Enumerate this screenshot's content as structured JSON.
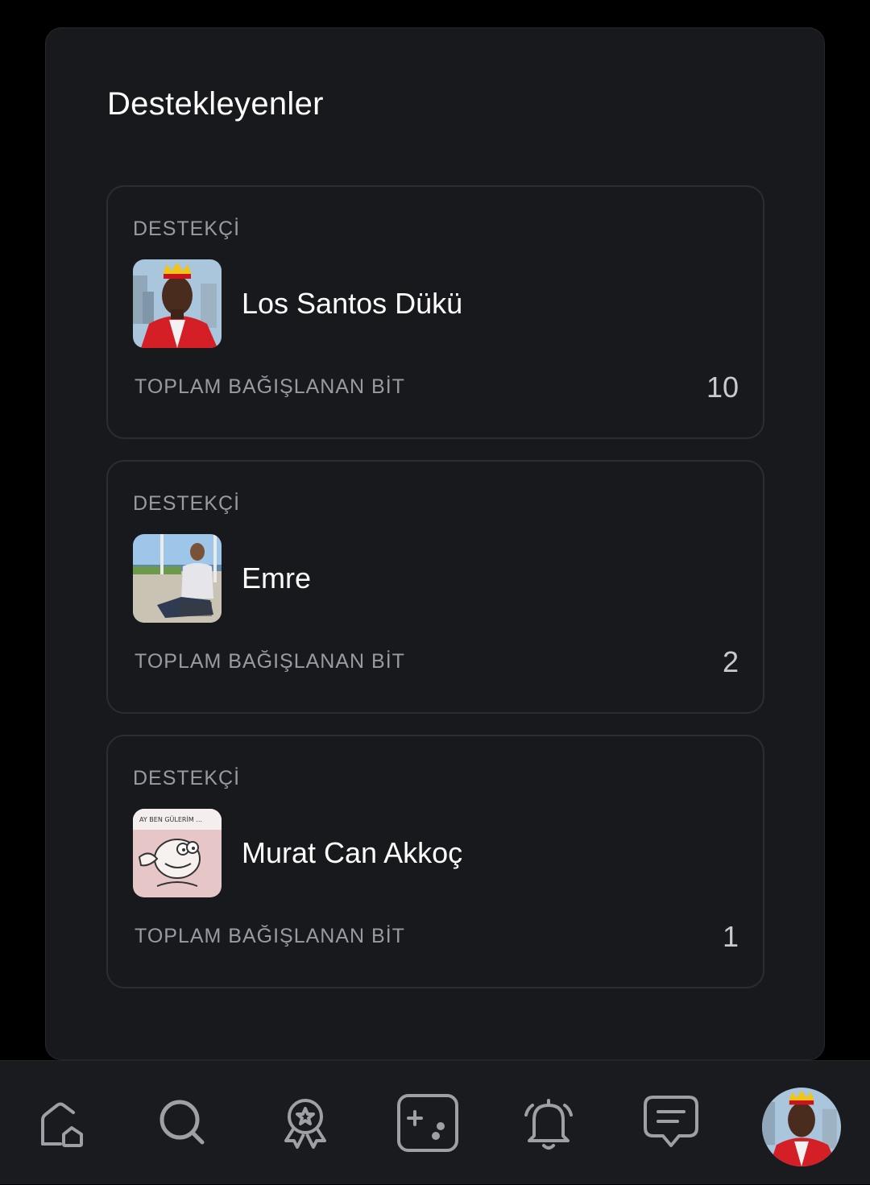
{
  "panel": {
    "title": "Destekleyenler"
  },
  "supporters": [
    {
      "role_label": "DESTEKÇİ",
      "name": "Los Santos Dükü",
      "total_label": "TOPLAM BAĞIŞLANAN BİT",
      "total_value": "10",
      "avatar": "king-avatar"
    },
    {
      "role_label": "DESTEKÇİ",
      "name": "Emre",
      "total_label": "TOPLAM BAĞIŞLANAN BİT",
      "total_value": "2",
      "avatar": "photo-avatar"
    },
    {
      "role_label": "DESTEKÇİ",
      "name": "Murat Can Akkoç",
      "total_label": "TOPLAM BAĞIŞLANAN BİT",
      "total_value": "1",
      "avatar": "cartoon-avatar",
      "avatar_caption": "AY BEN GÜLERİM ..."
    }
  ],
  "bottom_nav": {
    "items": [
      "home-icon",
      "search-icon",
      "award-icon",
      "gamepad-icon",
      "bell-icon",
      "chat-icon",
      "profile-avatar"
    ]
  },
  "colors": {
    "background": "#000000",
    "panel": "#18191d",
    "card_border": "#2c2d33",
    "muted_text": "#9a9ba2",
    "nav_icon": "#9fa0a6"
  }
}
